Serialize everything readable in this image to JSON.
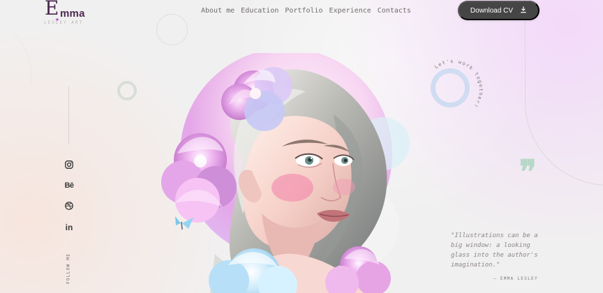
{
  "brand": {
    "initial": "E",
    "name": "mma",
    "subtitle": "LESLEY ART",
    "accent_color": "#b53bd6",
    "logo_color": "#4b2750"
  },
  "nav": {
    "items": [
      {
        "label": "About me"
      },
      {
        "label": "Education"
      },
      {
        "label": "Portfolio"
      },
      {
        "label": "Experience"
      },
      {
        "label": "Contacts"
      }
    ]
  },
  "header": {
    "cv_button_label": "Download CV",
    "cv_icon": "download-icon",
    "button_color": "#454545"
  },
  "hero": {
    "circular_caption": "Let's work together!",
    "portrait_alt": "Illustrated portrait of a woman with flowers in her hair",
    "colors": {
      "pink": "#e6a9ea",
      "blue": "#cfe5f6",
      "skin": "#f7d6cf",
      "hair": "#b7b7b2"
    }
  },
  "social": {
    "items": [
      {
        "name": "Instagram",
        "icon": "instagram-icon"
      },
      {
        "name": "Behance",
        "label": "Bē",
        "icon": "behance-icon"
      },
      {
        "name": "Dribbble",
        "icon": "dribbble-icon"
      },
      {
        "name": "LinkedIn",
        "label": "in",
        "icon": "linkedin-icon"
      }
    ],
    "follow_label": "FOLLOW ME"
  },
  "quote": {
    "text": "\"Illustrations can be a\nbig window: a looking\nglass into the author's\nimagination.\"",
    "author": "— EMMA LESLEY"
  }
}
